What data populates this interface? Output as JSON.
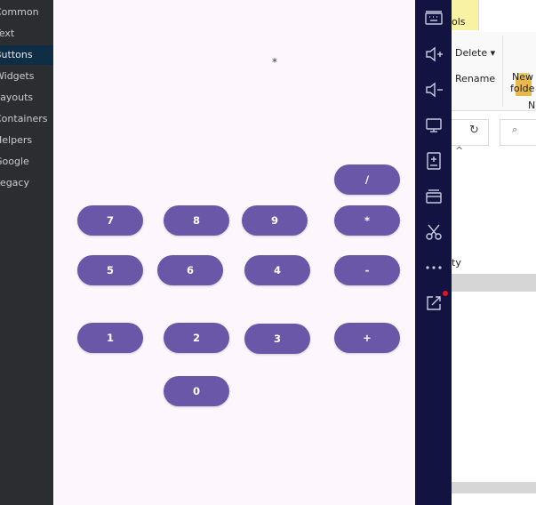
{
  "palette": {
    "items": [
      {
        "label": "Common",
        "active": false
      },
      {
        "label": "Text",
        "active": false
      },
      {
        "label": "Buttons",
        "active": true
      },
      {
        "label": "Widgets",
        "active": false
      },
      {
        "label": "Layouts",
        "active": false
      },
      {
        "label": "Containers",
        "active": false
      },
      {
        "label": "Helpers",
        "active": false
      },
      {
        "label": "Google",
        "active": false
      },
      {
        "label": "Legacy",
        "active": false
      }
    ]
  },
  "calculator": {
    "display": "*",
    "keys": {
      "divide": "/",
      "seven": "7",
      "eight": "8",
      "nine": "9",
      "multiply": "*",
      "five": "5",
      "six": "6",
      "four": "4",
      "minus": "-",
      "one": "1",
      "two": "2",
      "three": "3",
      "plus": "+",
      "zero": "0"
    },
    "key_color": "#6a57a8",
    "background": "#fdf7fd"
  },
  "toolbar": {
    "background": "#131341",
    "buttons": [
      "keyboard-icon",
      "volume-up-icon",
      "volume-down-icon",
      "display-icon",
      "install-apk-icon",
      "window-icon",
      "cut-icon",
      "more-icon",
      "external-link-icon"
    ]
  },
  "explorer": {
    "tools_tab": "ols",
    "delete_label": "Delete",
    "rename_label": "Rename",
    "new_folder_line1": "New",
    "new_folder_line2": "folde",
    "group_letter": "N",
    "list_text": "ty"
  }
}
